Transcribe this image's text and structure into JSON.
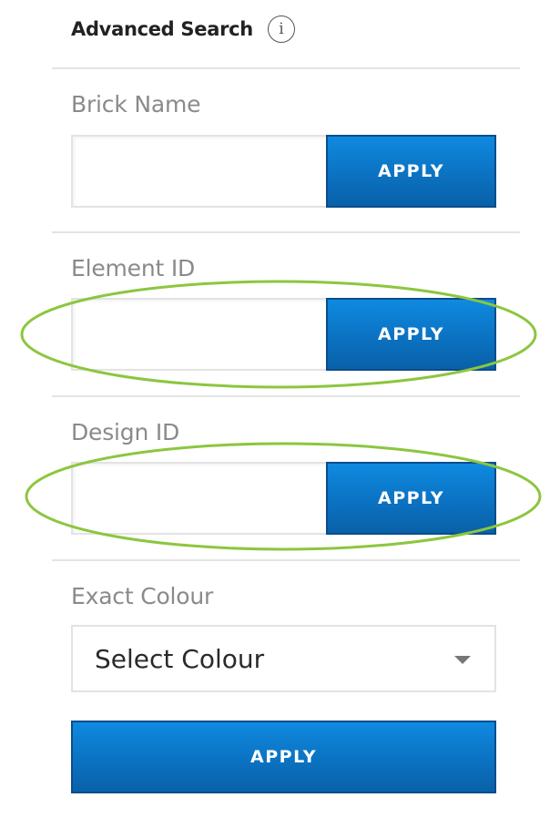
{
  "header": {
    "title": "Advanced Search",
    "info_icon": "i"
  },
  "fields": [
    {
      "label": "Brick Name",
      "value": "",
      "button_label": "APPLY"
    },
    {
      "label": "Element ID",
      "value": "",
      "button_label": "APPLY"
    },
    {
      "label": "Design ID",
      "value": "",
      "button_label": "APPLY"
    }
  ],
  "colour": {
    "label": "Exact Colour",
    "selected": "Select Colour"
  },
  "footer": {
    "apply_label": "APPLY"
  },
  "colors": {
    "button_blue": "#0b72c2",
    "annotation_green": "#8cc63f"
  },
  "icons": {
    "info": "info-icon",
    "select_caret": "chevron-down-icon"
  }
}
